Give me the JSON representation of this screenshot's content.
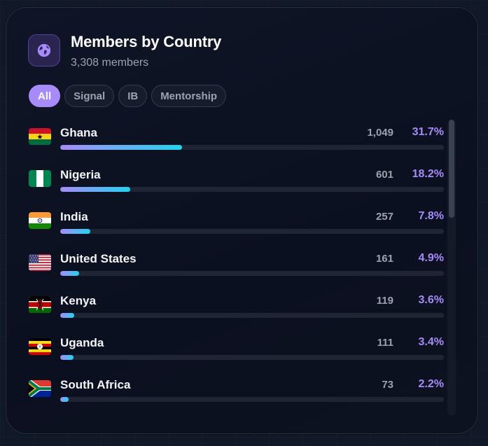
{
  "header": {
    "icon": "globe-icon",
    "title": "Members by Country",
    "subtitle": "3,308 members"
  },
  "filters": [
    {
      "label": "All",
      "active": true
    },
    {
      "label": "Signal",
      "active": false
    },
    {
      "label": "IB",
      "active": false
    },
    {
      "label": "Mentorship",
      "active": false
    }
  ],
  "countries": [
    {
      "name": "Ghana",
      "count": "1,049",
      "percent": "31.7%",
      "bar_fraction": 0.317
    },
    {
      "name": "Nigeria",
      "count": "601",
      "percent": "18.2%",
      "bar_fraction": 0.182
    },
    {
      "name": "India",
      "count": "257",
      "percent": "7.8%",
      "bar_fraction": 0.078
    },
    {
      "name": "United States",
      "count": "161",
      "percent": "4.9%",
      "bar_fraction": 0.049
    },
    {
      "name": "Kenya",
      "count": "119",
      "percent": "3.6%",
      "bar_fraction": 0.036
    },
    {
      "name": "Uganda",
      "count": "111",
      "percent": "3.4%",
      "bar_fraction": 0.034
    },
    {
      "name": "South Africa",
      "count": "73",
      "percent": "2.2%",
      "bar_fraction": 0.022
    }
  ],
  "colors": {
    "accent": "#a78bfa",
    "bar_start": "#a78bfa",
    "bar_end": "#22d3ee"
  }
}
